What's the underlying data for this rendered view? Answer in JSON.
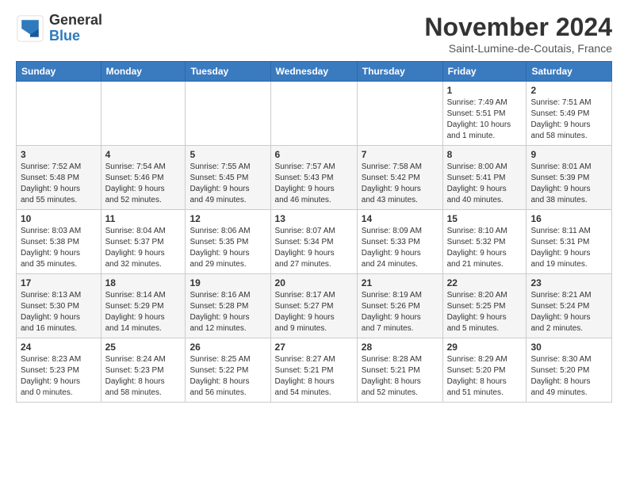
{
  "header": {
    "logo_general": "General",
    "logo_blue": "Blue",
    "month_title": "November 2024",
    "location": "Saint-Lumine-de-Coutais, France"
  },
  "weekdays": [
    "Sunday",
    "Monday",
    "Tuesday",
    "Wednesday",
    "Thursday",
    "Friday",
    "Saturday"
  ],
  "weeks": [
    [
      {
        "day": "",
        "info": ""
      },
      {
        "day": "",
        "info": ""
      },
      {
        "day": "",
        "info": ""
      },
      {
        "day": "",
        "info": ""
      },
      {
        "day": "",
        "info": ""
      },
      {
        "day": "1",
        "info": "Sunrise: 7:49 AM\nSunset: 5:51 PM\nDaylight: 10 hours\nand 1 minute."
      },
      {
        "day": "2",
        "info": "Sunrise: 7:51 AM\nSunset: 5:49 PM\nDaylight: 9 hours\nand 58 minutes."
      }
    ],
    [
      {
        "day": "3",
        "info": "Sunrise: 7:52 AM\nSunset: 5:48 PM\nDaylight: 9 hours\nand 55 minutes."
      },
      {
        "day": "4",
        "info": "Sunrise: 7:54 AM\nSunset: 5:46 PM\nDaylight: 9 hours\nand 52 minutes."
      },
      {
        "day": "5",
        "info": "Sunrise: 7:55 AM\nSunset: 5:45 PM\nDaylight: 9 hours\nand 49 minutes."
      },
      {
        "day": "6",
        "info": "Sunrise: 7:57 AM\nSunset: 5:43 PM\nDaylight: 9 hours\nand 46 minutes."
      },
      {
        "day": "7",
        "info": "Sunrise: 7:58 AM\nSunset: 5:42 PM\nDaylight: 9 hours\nand 43 minutes."
      },
      {
        "day": "8",
        "info": "Sunrise: 8:00 AM\nSunset: 5:41 PM\nDaylight: 9 hours\nand 40 minutes."
      },
      {
        "day": "9",
        "info": "Sunrise: 8:01 AM\nSunset: 5:39 PM\nDaylight: 9 hours\nand 38 minutes."
      }
    ],
    [
      {
        "day": "10",
        "info": "Sunrise: 8:03 AM\nSunset: 5:38 PM\nDaylight: 9 hours\nand 35 minutes."
      },
      {
        "day": "11",
        "info": "Sunrise: 8:04 AM\nSunset: 5:37 PM\nDaylight: 9 hours\nand 32 minutes."
      },
      {
        "day": "12",
        "info": "Sunrise: 8:06 AM\nSunset: 5:35 PM\nDaylight: 9 hours\nand 29 minutes."
      },
      {
        "day": "13",
        "info": "Sunrise: 8:07 AM\nSunset: 5:34 PM\nDaylight: 9 hours\nand 27 minutes."
      },
      {
        "day": "14",
        "info": "Sunrise: 8:09 AM\nSunset: 5:33 PM\nDaylight: 9 hours\nand 24 minutes."
      },
      {
        "day": "15",
        "info": "Sunrise: 8:10 AM\nSunset: 5:32 PM\nDaylight: 9 hours\nand 21 minutes."
      },
      {
        "day": "16",
        "info": "Sunrise: 8:11 AM\nSunset: 5:31 PM\nDaylight: 9 hours\nand 19 minutes."
      }
    ],
    [
      {
        "day": "17",
        "info": "Sunrise: 8:13 AM\nSunset: 5:30 PM\nDaylight: 9 hours\nand 16 minutes."
      },
      {
        "day": "18",
        "info": "Sunrise: 8:14 AM\nSunset: 5:29 PM\nDaylight: 9 hours\nand 14 minutes."
      },
      {
        "day": "19",
        "info": "Sunrise: 8:16 AM\nSunset: 5:28 PM\nDaylight: 9 hours\nand 12 minutes."
      },
      {
        "day": "20",
        "info": "Sunrise: 8:17 AM\nSunset: 5:27 PM\nDaylight: 9 hours\nand 9 minutes."
      },
      {
        "day": "21",
        "info": "Sunrise: 8:19 AM\nSunset: 5:26 PM\nDaylight: 9 hours\nand 7 minutes."
      },
      {
        "day": "22",
        "info": "Sunrise: 8:20 AM\nSunset: 5:25 PM\nDaylight: 9 hours\nand 5 minutes."
      },
      {
        "day": "23",
        "info": "Sunrise: 8:21 AM\nSunset: 5:24 PM\nDaylight: 9 hours\nand 2 minutes."
      }
    ],
    [
      {
        "day": "24",
        "info": "Sunrise: 8:23 AM\nSunset: 5:23 PM\nDaylight: 9 hours\nand 0 minutes."
      },
      {
        "day": "25",
        "info": "Sunrise: 8:24 AM\nSunset: 5:23 PM\nDaylight: 8 hours\nand 58 minutes."
      },
      {
        "day": "26",
        "info": "Sunrise: 8:25 AM\nSunset: 5:22 PM\nDaylight: 8 hours\nand 56 minutes."
      },
      {
        "day": "27",
        "info": "Sunrise: 8:27 AM\nSunset: 5:21 PM\nDaylight: 8 hours\nand 54 minutes."
      },
      {
        "day": "28",
        "info": "Sunrise: 8:28 AM\nSunset: 5:21 PM\nDaylight: 8 hours\nand 52 minutes."
      },
      {
        "day": "29",
        "info": "Sunrise: 8:29 AM\nSunset: 5:20 PM\nDaylight: 8 hours\nand 51 minutes."
      },
      {
        "day": "30",
        "info": "Sunrise: 8:30 AM\nSunset: 5:20 PM\nDaylight: 8 hours\nand 49 minutes."
      }
    ]
  ]
}
